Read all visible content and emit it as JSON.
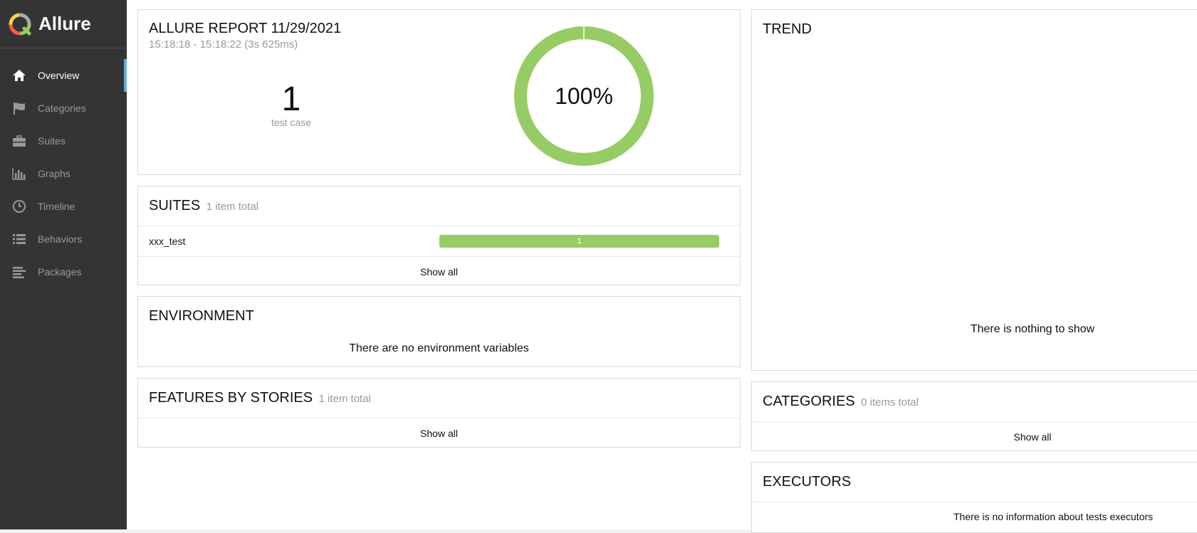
{
  "brand": {
    "name": "Allure"
  },
  "sidebar": {
    "items": [
      {
        "label": "Overview",
        "icon": "home-icon",
        "active": true
      },
      {
        "label": "Categories",
        "icon": "flag-icon",
        "active": false
      },
      {
        "label": "Suites",
        "icon": "briefcase-icon",
        "active": false
      },
      {
        "label": "Graphs",
        "icon": "bar-chart-icon",
        "active": false
      },
      {
        "label": "Timeline",
        "icon": "clock-icon",
        "active": false
      },
      {
        "label": "Behaviors",
        "icon": "list-icon",
        "active": false
      },
      {
        "label": "Packages",
        "icon": "align-left-icon",
        "active": false
      }
    ]
  },
  "summary": {
    "title": "ALLURE REPORT 11/29/2021",
    "time": "15:18:18 - 15:18:22 (3s 625ms)",
    "count": "1",
    "count_label": "test case",
    "percent_label": "100%",
    "passed_fraction": 1.0,
    "color_passed": "#97cc64"
  },
  "suites": {
    "title": "SUITES",
    "subtitle": "1 item total",
    "rows": [
      {
        "name": "xxx_test",
        "bar_value": "1"
      }
    ],
    "show_all": "Show all"
  },
  "environment": {
    "title": "ENVIRONMENT",
    "message": "There are no environment variables"
  },
  "features": {
    "title": "FEATURES BY STORIES",
    "subtitle": "1 item total",
    "show_all": "Show all"
  },
  "trend": {
    "title": "TREND",
    "message": "There is nothing to show"
  },
  "categories": {
    "title": "CATEGORIES",
    "subtitle": "0 items total",
    "show_all": "Show all"
  },
  "executors": {
    "title": "EXECUTORS",
    "message": "There is no information about tests executors"
  }
}
